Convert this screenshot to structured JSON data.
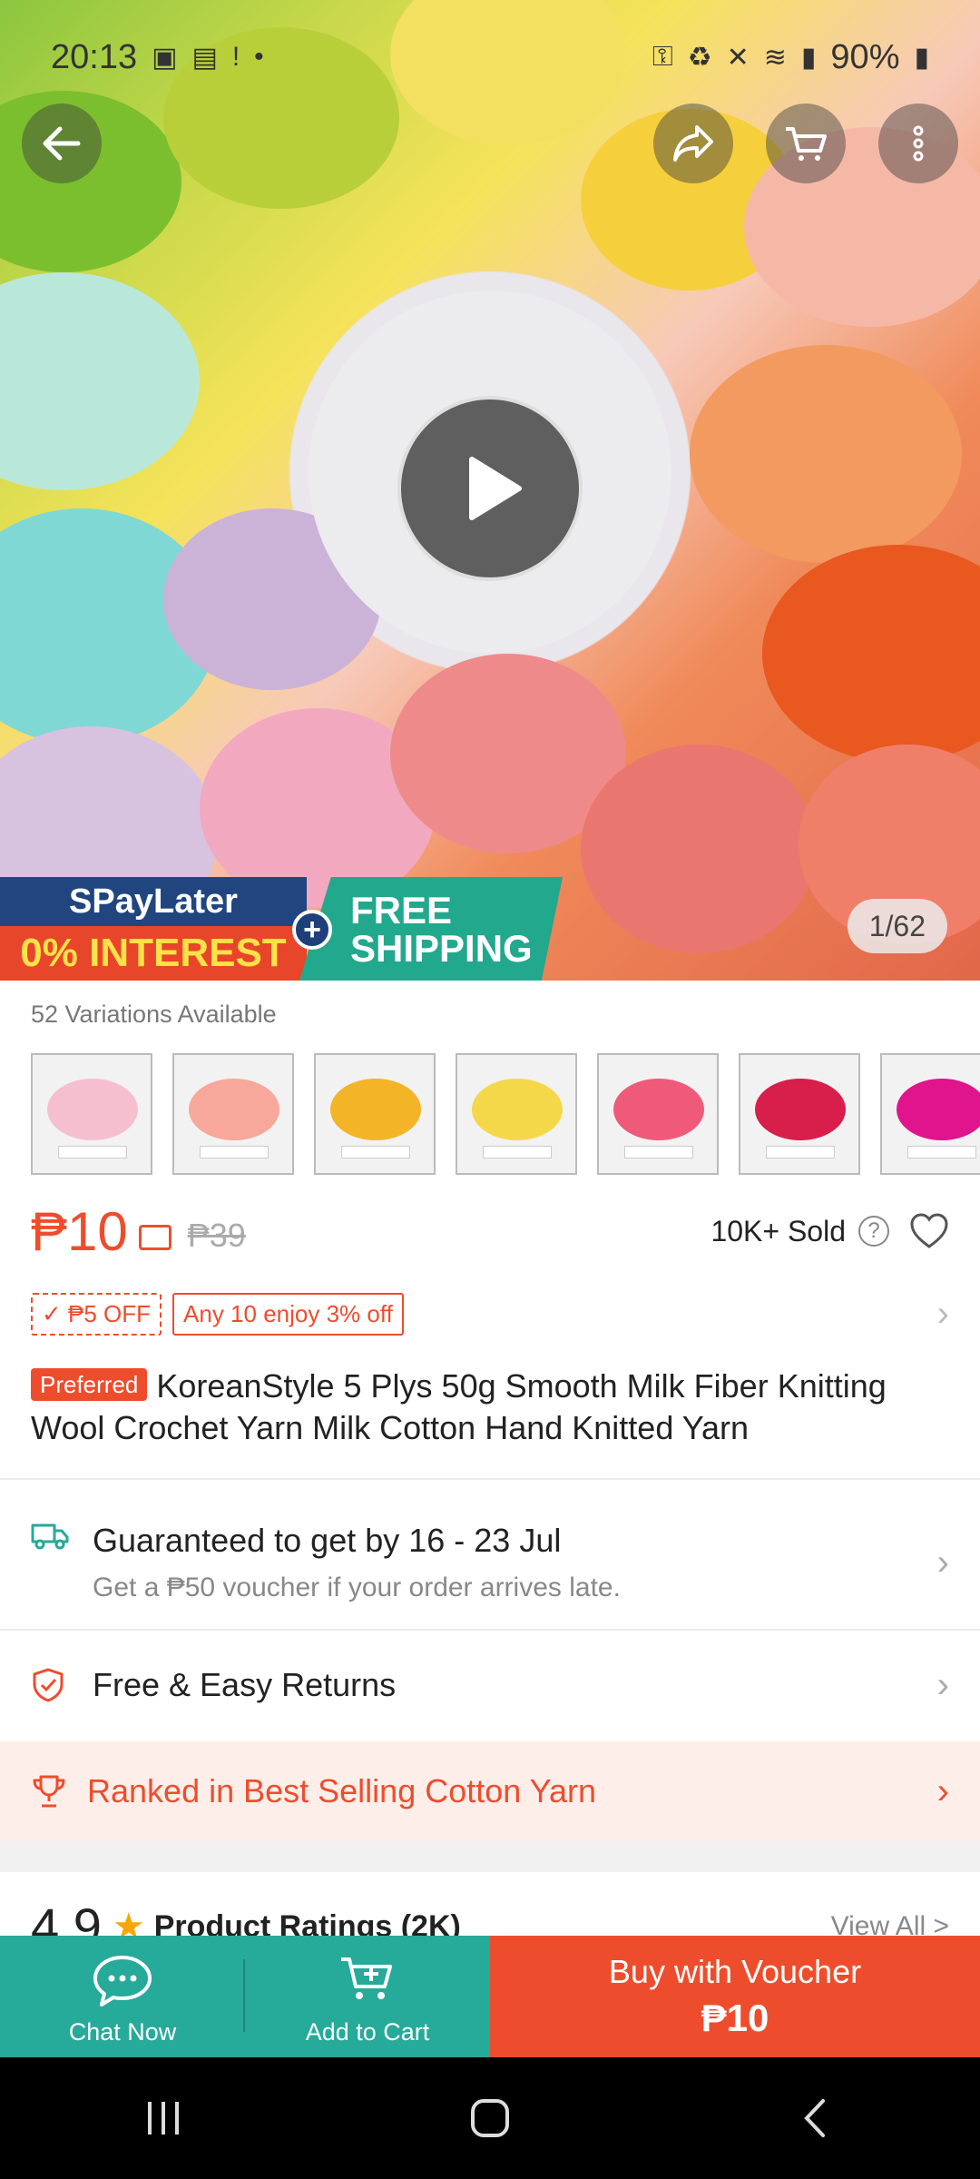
{
  "status_bar": {
    "time": "20:13",
    "battery": "90%"
  },
  "hero": {
    "image_counter": "1/62",
    "promo_spaylater": "SPayLater",
    "promo_interest": "0% INTEREST",
    "promo_shipping_line1": "FREE",
    "promo_shipping_line2": "SHIPPING"
  },
  "variations": {
    "label": "52 Variations Available",
    "swatch_colors": [
      "#f6bfd0",
      "#f7a89a",
      "#f4b428",
      "#f4d84a",
      "#ef5a7a",
      "#d81e4a",
      "#e0148c"
    ]
  },
  "price": {
    "current": "₱10",
    "original": "₱39",
    "sold": "10K+ Sold",
    "help": "?"
  },
  "tags": {
    "discount": "₱5 OFF",
    "bundle": "Any 10 enjoy 3% off"
  },
  "product": {
    "badge": "Preferred",
    "title": "KoreanStyle 5 Plys 50g Smooth Milk Fiber Knitting Wool Crochet Yarn Milk Cotton Hand Knitted Yarn"
  },
  "shipping": {
    "title": "Guaranteed to get by 16 - 23 Jul",
    "subtitle": "Get a ₱50 voucher if your order arrives late."
  },
  "returns": {
    "title": "Free & Easy Returns"
  },
  "ranked": {
    "text": "Ranked in Best Selling Cotton Yarn"
  },
  "ratings": {
    "score": "4.9",
    "label": "Product Ratings (2K)",
    "view_all": "View All >"
  },
  "bottom_bar": {
    "chat": "Chat Now",
    "cart": "Add to Cart",
    "buy_line1": "Buy with Voucher",
    "buy_line2": "₱10"
  },
  "colors": {
    "accent": "#ee4d2d",
    "teal": "#26aa99"
  }
}
